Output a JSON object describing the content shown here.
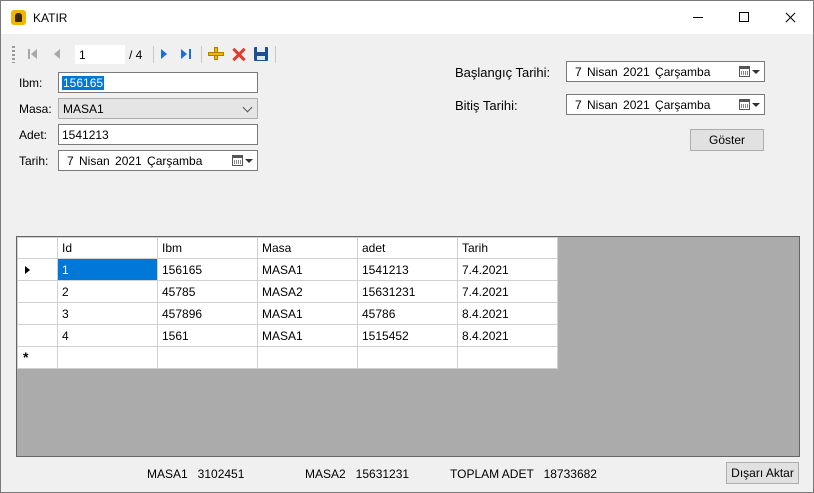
{
  "window": {
    "title": "KATIR",
    "minimize_icon": "minimize-icon",
    "maximize_icon": "maximize-icon",
    "close_icon": "close-icon"
  },
  "navigator": {
    "position": "1",
    "count_label": "/ 4",
    "icons": [
      "move-first-icon",
      "move-previous-icon",
      "move-next-icon",
      "move-last-icon",
      "add-new-icon",
      "delete-icon",
      "save-icon"
    ]
  },
  "form": {
    "ibm_label": "Ibm:",
    "ibm_value": "156165",
    "masa_label": "Masa:",
    "masa_value": "MASA1",
    "adet_label": "Adet:",
    "adet_value": "1541213",
    "tarih_label": "Tarih:",
    "tarih_value": "7  Nisan   2021 Çarşamba"
  },
  "filter": {
    "start_label": "Başlangıç Tarihi:",
    "start_value": "7  Nisan   2021 Çarşamba",
    "end_label": "Bitiş Tarihi:",
    "end_value": "7  Nisan   2021 Çarşamba",
    "show_button": "Göster"
  },
  "grid": {
    "columns": [
      "Id",
      "Ibm",
      "Masa",
      "adet",
      "Tarih"
    ],
    "rows": [
      [
        "1",
        "156165",
        "MASA1",
        "1541213",
        "7.4.2021"
      ],
      [
        "2",
        "45785",
        "MASA2",
        "15631231",
        "7.4.2021"
      ],
      [
        "3",
        "457896",
        "MASA1",
        "45786",
        "8.4.2021"
      ],
      [
        "4",
        "1561",
        "MASA1",
        "1515452",
        "8.4.2021"
      ]
    ],
    "new_row_marker": "*"
  },
  "summary": {
    "masa1": "MASA1   3102451",
    "masa2": "MASA2   15631231",
    "total": "TOPLAM ADET   18733682"
  },
  "export_button": "Dışarı Aktar",
  "colors": {
    "selection": "#0078d7",
    "grid_background": "#ababab",
    "delete_red": "#e03a2a",
    "add_yellow": "#f3b400"
  }
}
